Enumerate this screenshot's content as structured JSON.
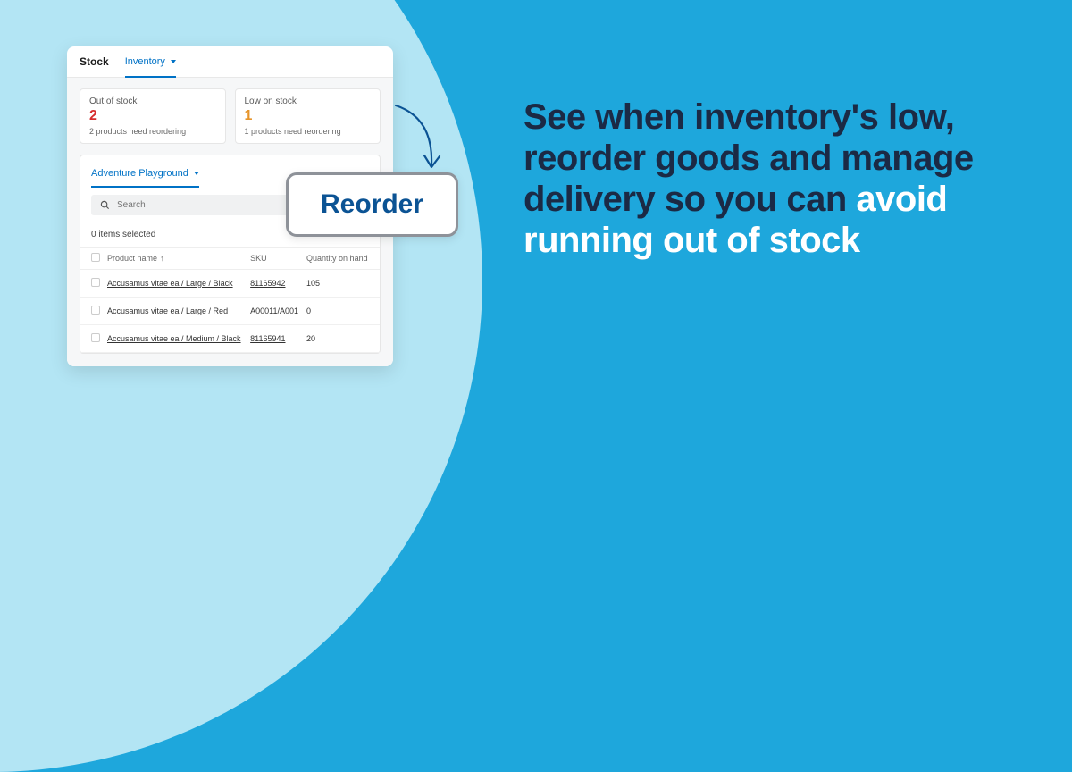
{
  "topbar": {
    "title": "Stock",
    "tab": "Inventory"
  },
  "cards": {
    "out": {
      "title": "Out of stock",
      "count": "2",
      "sub": "2 products need reordering"
    },
    "low": {
      "title": "Low on stock",
      "count": "1",
      "sub": "1 products need reordering"
    }
  },
  "filter": {
    "label": "Adventure Playground"
  },
  "search": {
    "placeholder": "Search"
  },
  "selection": {
    "text": "0 items selected"
  },
  "columns": {
    "name": "Product name",
    "sku": "SKU",
    "qty": "Quantity on hand"
  },
  "rows": [
    {
      "name": "Accusamus vitae ea / Large / Black",
      "sku": "81165942",
      "qty": "105"
    },
    {
      "name": "Accusamus vitae ea / Large / Red",
      "sku": "A00011/A001",
      "qty": "0"
    },
    {
      "name": "Accusamus vitae ea / Medium / Black",
      "sku": "81165941",
      "qty": "20"
    }
  ],
  "reorder": {
    "label": "Reorder"
  },
  "headline": {
    "part1": "See when inventory's low, reorder goods and manage delivery so you can ",
    "highlight": "avoid running out of stock"
  }
}
